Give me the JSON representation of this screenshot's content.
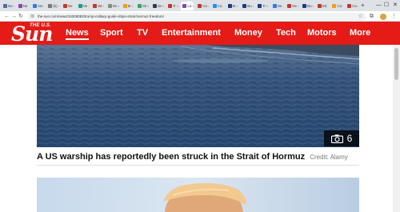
{
  "browser": {
    "tabs": [
      {
        "label": "Ne",
        "color": "#4a6fa5"
      },
      {
        "label": "Ne",
        "color": "#8e44ad"
      },
      {
        "label": "Ne",
        "color": "#2c7be5"
      },
      {
        "label": "(b)",
        "color": "#777777"
      },
      {
        "label": "Ne",
        "color": "#c0392b"
      },
      {
        "label": "Ne",
        "color": "#16a085"
      },
      {
        "label": "WI",
        "color": "#c0392b"
      },
      {
        "label": "Mi",
        "color": "#888888"
      },
      {
        "label": "M",
        "color": "#f39c12"
      },
      {
        "label": "Mi",
        "color": "#27ae60"
      },
      {
        "label": "de",
        "color": "#2c3e50"
      },
      {
        "label": "Tr",
        "color": "#c0392b"
      },
      {
        "label": "La",
        "color": "#8e44ad"
      },
      {
        "label": "Ca",
        "color": "#c0392b"
      },
      {
        "label": "Ca",
        "color": "#1e90ff"
      },
      {
        "label": "M",
        "color": "#1e3a8a"
      },
      {
        "label": "Bu",
        "color": "#1e3a8a"
      },
      {
        "label": "Tr",
        "color": "#1e3a8a"
      },
      {
        "label": "Ne",
        "color": "#2c7be5"
      },
      {
        "label": "Ne",
        "color": "#c0392b"
      },
      {
        "label": "Bu",
        "color": "#1e3a8a"
      },
      {
        "label": "Ed",
        "color": "#c0392b"
      },
      {
        "label": "Ca",
        "color": "#f39c12"
      },
      {
        "label": "Ca",
        "color": "#c0392b"
      }
    ],
    "new_tab": "+",
    "window_controls": {
      "minimize": "—",
      "maximize": "☐",
      "close": "✕"
    },
    "nav": {
      "back": "←",
      "forward": "→",
      "reload": "↻"
    },
    "url": "the-sun.com/news/15308082/trump-military-guide-ships-strait-hormuz-freedom/",
    "icons": [
      "lock-icon",
      "star-icon",
      "translate-icon",
      "extensions-icon",
      "menu-icon"
    ]
  },
  "site": {
    "logo": {
      "the": "THE U.S.",
      "sun": "Sun"
    },
    "nav": [
      "News",
      "Sport",
      "TV",
      "Entertainment",
      "Money",
      "Tech",
      "Motors",
      "More"
    ],
    "active_nav": "News",
    "brand_color": "#e41b17"
  },
  "article": {
    "gallery_count": "6",
    "caption": "A US warship has reportedly been struck in the Strait of Hormuz",
    "credit": "Credit: Alamy"
  }
}
